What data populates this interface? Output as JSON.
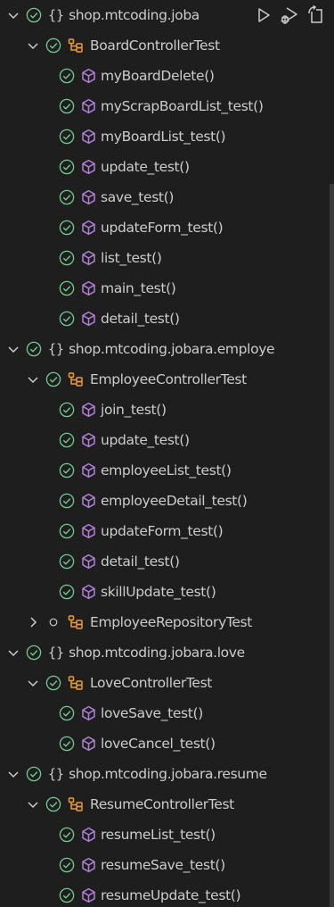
{
  "colors": {
    "background": "#1e1e1e",
    "text": "#cccccc",
    "passed": "#73c991",
    "class_icon": "#ee9d28",
    "method_icon": "#b180d7",
    "not_run": "#c5c5c5"
  },
  "tree": [
    {
      "level": 0,
      "kind": "namespace",
      "expanded": true,
      "status": "passed",
      "label": "shop.mtcoding.jobara.board",
      "display": "shop.mtcoding.joba",
      "actions": [
        "run-icon",
        "debug-icon",
        "go-to-file-icon"
      ]
    },
    {
      "level": 1,
      "kind": "class",
      "expanded": true,
      "status": "passed",
      "label": "BoardControllerTest"
    },
    {
      "level": 2,
      "kind": "method",
      "status": "passed",
      "label": "myBoardDelete()"
    },
    {
      "level": 2,
      "kind": "method",
      "status": "passed",
      "label": "myScrapBoardList_test()"
    },
    {
      "level": 2,
      "kind": "method",
      "status": "passed",
      "label": "myBoardList_test()"
    },
    {
      "level": 2,
      "kind": "method",
      "status": "passed",
      "label": "update_test()"
    },
    {
      "level": 2,
      "kind": "method",
      "status": "passed",
      "label": "save_test()"
    },
    {
      "level": 2,
      "kind": "method",
      "status": "passed",
      "label": "updateForm_test()"
    },
    {
      "level": 2,
      "kind": "method",
      "status": "passed",
      "label": "list_test()"
    },
    {
      "level": 2,
      "kind": "method",
      "status": "passed",
      "label": "main_test()"
    },
    {
      "level": 2,
      "kind": "method",
      "status": "passed",
      "label": "detail_test()"
    },
    {
      "level": 0,
      "kind": "namespace",
      "expanded": true,
      "status": "passed",
      "label": "shop.mtcoding.jobara.employee",
      "display": "shop.mtcoding.jobara.employe"
    },
    {
      "level": 1,
      "kind": "class",
      "expanded": true,
      "status": "passed",
      "label": "EmployeeControllerTest"
    },
    {
      "level": 2,
      "kind": "method",
      "status": "passed",
      "label": "join_test()"
    },
    {
      "level": 2,
      "kind": "method",
      "status": "passed",
      "label": "update_test()"
    },
    {
      "level": 2,
      "kind": "method",
      "status": "passed",
      "label": "employeeList_test()"
    },
    {
      "level": 2,
      "kind": "method",
      "status": "passed",
      "label": "employeeDetail_test()"
    },
    {
      "level": 2,
      "kind": "method",
      "status": "passed",
      "label": "updateForm_test()"
    },
    {
      "level": 2,
      "kind": "method",
      "status": "passed",
      "label": "detail_test()"
    },
    {
      "level": 2,
      "kind": "method",
      "status": "passed",
      "label": "skillUpdate_test()"
    },
    {
      "level": 1,
      "kind": "class",
      "expanded": false,
      "status": "not-run",
      "label": "EmployeeRepositoryTest"
    },
    {
      "level": 0,
      "kind": "namespace",
      "expanded": true,
      "status": "passed",
      "label": "shop.mtcoding.jobara.love"
    },
    {
      "level": 1,
      "kind": "class",
      "expanded": true,
      "status": "passed",
      "label": "LoveControllerTest"
    },
    {
      "level": 2,
      "kind": "method",
      "status": "passed",
      "label": "loveSave_test()"
    },
    {
      "level": 2,
      "kind": "method",
      "status": "passed",
      "label": "loveCancel_test()"
    },
    {
      "level": 0,
      "kind": "namespace",
      "expanded": true,
      "status": "passed",
      "label": "shop.mtcoding.jobara.resume"
    },
    {
      "level": 1,
      "kind": "class",
      "expanded": true,
      "status": "passed",
      "label": "ResumeControllerTest"
    },
    {
      "level": 2,
      "kind": "method",
      "status": "passed",
      "label": "resumeList_test()"
    },
    {
      "level": 2,
      "kind": "method",
      "status": "passed",
      "label": "resumeSave_test()"
    },
    {
      "level": 2,
      "kind": "method",
      "status": "passed",
      "label": "resumeUpdate_test()"
    }
  ]
}
